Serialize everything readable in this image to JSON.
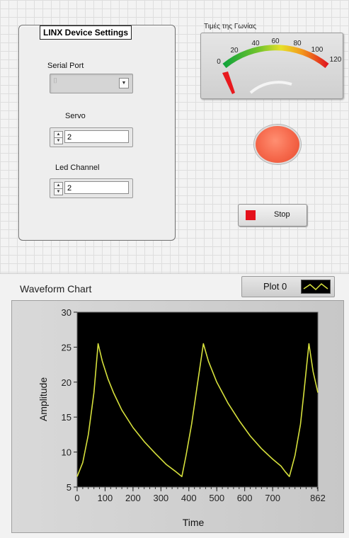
{
  "linx": {
    "title": "LINX Device Settings",
    "serial_port": {
      "label": "Serial Port",
      "value": ""
    },
    "servo": {
      "label": "Servo",
      "value": "2"
    },
    "led_channel": {
      "label": "Led Channel",
      "value": "2"
    }
  },
  "gauge": {
    "label": "Τιμές της Γωνίας",
    "min": 0,
    "max": 120,
    "ticks": [
      "0",
      "20",
      "40",
      "60",
      "80",
      "100",
      "120"
    ],
    "value": 0,
    "needle_color": "#e8191e"
  },
  "led": {
    "state": "on",
    "color": "#f6694c"
  },
  "stop_button": {
    "label": "Stop",
    "icon": "stop-square-icon",
    "color": "#e4101b"
  },
  "legend": {
    "label": "Plot 0",
    "line_color": "#d6e03c"
  },
  "chart_data": {
    "type": "line",
    "title": "Waveform Chart",
    "xlabel": "Time",
    "ylabel": "Amplitude",
    "xlim": [
      0,
      862
    ],
    "ylim": [
      5,
      30
    ],
    "x_ticks": [
      "0",
      "100",
      "200",
      "300",
      "400",
      "500",
      "600",
      "700",
      "862"
    ],
    "y_ticks": [
      "5",
      "10",
      "15",
      "20",
      "25",
      "30"
    ],
    "plot_background": "#000000",
    "series": [
      {
        "name": "Plot 0",
        "color": "#d6e03c",
        "x": [
          0,
          20,
          40,
          60,
          75,
          90,
          110,
          130,
          160,
          200,
          240,
          280,
          320,
          350,
          375,
          390,
          410,
          430,
          452,
          470,
          500,
          540,
          580,
          620,
          660,
          700,
          730,
          745,
          760,
          780,
          800,
          812,
          830,
          845,
          862
        ],
        "y": [
          6.5,
          8.5,
          12.5,
          18.5,
          25.5,
          23,
          20.5,
          18.5,
          16,
          13.5,
          11.5,
          9.8,
          8.2,
          7.3,
          6.5,
          9.5,
          14,
          19.5,
          25.5,
          23,
          20,
          17,
          14.5,
          12.3,
          10.5,
          9,
          8,
          7.2,
          6.5,
          9.5,
          14,
          18.5,
          25.5,
          21.5,
          18.5
        ]
      }
    ]
  }
}
